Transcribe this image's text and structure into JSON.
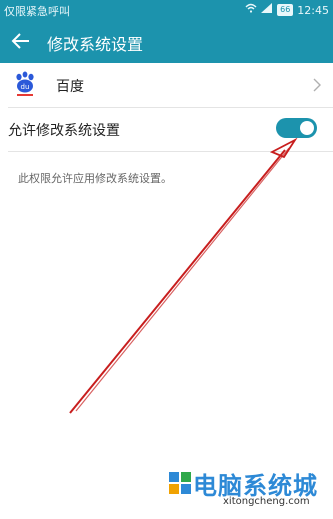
{
  "status_bar": {
    "carrier_text": "仅限紧急呼叫",
    "icons": [
      "picture-icon",
      "wifi-icon",
      "signal-icon"
    ],
    "battery": "66",
    "time": "12:45"
  },
  "app_bar": {
    "back_icon": "arrow-left-icon",
    "title": "修改系统设置"
  },
  "app_row": {
    "icon": "baidu-paw-icon",
    "name": "百度"
  },
  "setting": {
    "label": "允许修改系统设置",
    "enabled": true
  },
  "description": "此权限允许应用修改系统设置。",
  "annotation": {
    "arrow_color": "#c81e1e"
  },
  "watermark": {
    "title": "电脑系统城",
    "url": "xitongcheng.com"
  },
  "colors": {
    "primary": "#1c93ad",
    "toggle_knob": "#ffffff"
  }
}
